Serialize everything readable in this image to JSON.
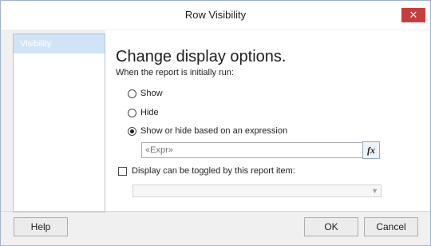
{
  "window": {
    "title": "Row Visibility",
    "close_label": "✕"
  },
  "sidebar": {
    "items": [
      {
        "label": "Visibility",
        "selected": true
      }
    ]
  },
  "main": {
    "heading": "Change display options.",
    "subheading": "When the report is initially run:",
    "radios": [
      {
        "label": "Show",
        "checked": false
      },
      {
        "label": "Hide",
        "checked": false
      },
      {
        "label": "Show or hide based on an expression",
        "checked": true
      }
    ],
    "expression_placeholder": "«Expr»",
    "fx_label": "fx",
    "toggle_checkbox": {
      "label": "Display can be toggled by this report item:",
      "checked": false
    },
    "toggle_dropdown": {
      "selected": "",
      "enabled": false
    }
  },
  "footer": {
    "help_label": "Help",
    "ok_label": "OK",
    "cancel_label": "Cancel"
  },
  "colors": {
    "close_button": "#c83c3c",
    "sidebar_selected": "#cfe4f7"
  }
}
